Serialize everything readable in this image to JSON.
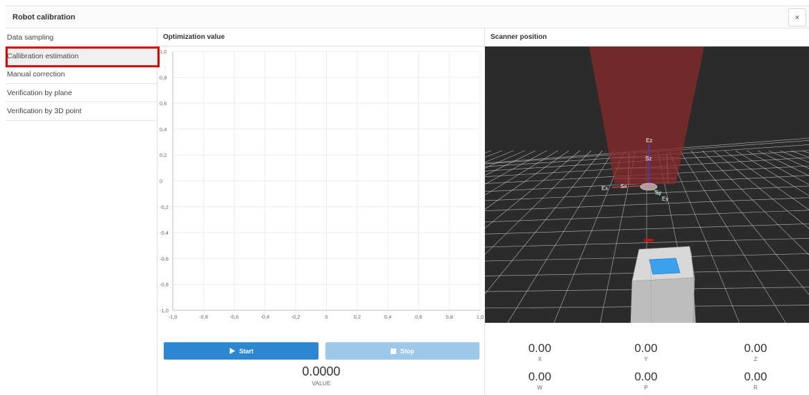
{
  "window": {
    "title": "Robot calibration",
    "close_symbol": "×"
  },
  "sidebar": {
    "items": [
      {
        "label": "Data sampling"
      },
      {
        "label": "Callibration estimation"
      },
      {
        "label": "Manual correction"
      },
      {
        "label": "Verification by plane"
      },
      {
        "label": "Verification by 3D point"
      }
    ],
    "active_index": 1
  },
  "optimization": {
    "header": "Optimization value",
    "start_label": "Start",
    "stop_label": "Stop",
    "value": "0.0000",
    "value_label": "VALUE",
    "chart_data": {
      "type": "line",
      "title": "",
      "xlabel": "",
      "ylabel": "",
      "xlim": [
        -1.0,
        1.0
      ],
      "ylim": [
        -1.0,
        1.0
      ],
      "x_ticks": [
        "-1,0",
        "-0,8",
        "-0,6",
        "-0,4",
        "-0,2",
        "0",
        "0,2",
        "0,4",
        "0,6",
        "0,8",
        "1,0"
      ],
      "y_ticks": [
        "1,0",
        "0,8",
        "0,6",
        "0,4",
        "0,2",
        "0",
        "-0,2",
        "-0,4",
        "-0,6",
        "-0,8",
        "-1,0"
      ],
      "grid": true,
      "series": []
    }
  },
  "scanner": {
    "header": "Scanner position",
    "axis_labels": {
      "ez": "Ez",
      "sz": "Sz",
      "ex": "Ex",
      "sx": "Sx",
      "sy": "Sy",
      "ey": "Ey"
    },
    "coords": [
      {
        "value": "0.00",
        "label": "X"
      },
      {
        "value": "0.00",
        "label": "Y"
      },
      {
        "value": "0.00",
        "label": "Z"
      },
      {
        "value": "0.00",
        "label": "W"
      },
      {
        "value": "0.00",
        "label": "P"
      },
      {
        "value": "0.00",
        "label": "R"
      }
    ]
  },
  "colors": {
    "accent": "#2d86d0",
    "accent_disabled": "#9ec8ea",
    "highlight": "#d40000",
    "scene_bg": "#2b2b2b",
    "beam": "#8a2b2b"
  }
}
